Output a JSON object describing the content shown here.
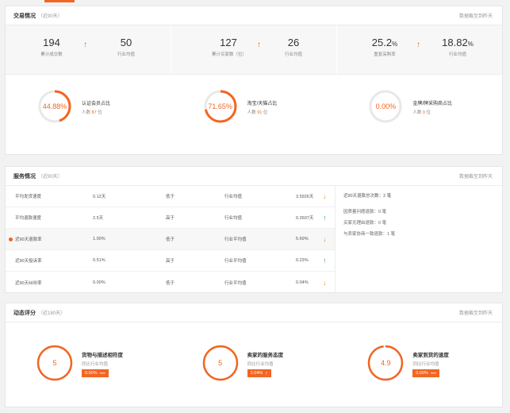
{
  "trade": {
    "title": "交易情况",
    "subtitle": "（近90天）",
    "note": "数据截至到昨天",
    "stats": [
      {
        "value": "194",
        "label": "累计成交数",
        "compare_value": "50",
        "compare_label": "行业均值"
      },
      {
        "value": "127",
        "label": "累计买家数（位）",
        "compare_value": "26",
        "compare_label": "行业均值"
      },
      {
        "value": "25.2",
        "unit": "%",
        "label": "重复采购率",
        "compare_value": "18.82",
        "compare_unit": "%",
        "compare_label": "行业均值"
      }
    ],
    "rings": [
      {
        "value": "44.88%",
        "percent": 44.88,
        "title": "认证会员占比",
        "sub_prefix": "人数",
        "sub_value": "87",
        "sub_suffix": "位"
      },
      {
        "value": "71.65%",
        "percent": 71.65,
        "title": "淘宝/天猫占比",
        "sub_prefix": "人数",
        "sub_value": "91",
        "sub_suffix": "位"
      },
      {
        "value": "0.00%",
        "percent": 0,
        "title": "金牌/牌采购商占比",
        "sub_prefix": "人数",
        "sub_value": "0",
        "sub_suffix": "位"
      }
    ]
  },
  "service": {
    "title": "服务情况",
    "subtitle": "（近90天）",
    "note": "数据截至到昨天",
    "rows": [
      {
        "name": "平均发货速度",
        "value": "0.12天",
        "cmp": "低于",
        "ref": "行业均值",
        "ref_value": "3.5926天",
        "trend": "down"
      },
      {
        "name": "平均退款速度",
        "value": "2.5天",
        "cmp": "高于",
        "ref": "行业均值",
        "ref_value": "0.2607天",
        "trend": "up"
      },
      {
        "name": "近90天退款率",
        "value": "1.00%",
        "cmp": "低于",
        "ref": "行业平均值",
        "ref_value": "5.69%",
        "trend": "down",
        "highlight": true
      },
      {
        "name": "近90天投诉率",
        "value": "0.51%",
        "cmp": "高于",
        "ref": "行业平均值",
        "ref_value": "0.23%",
        "trend": "up"
      },
      {
        "name": "近90天纠纷率",
        "value": "0.00%",
        "cmp": "低于",
        "ref": "行业平均值",
        "ref_value": "0.04%",
        "trend": "down"
      }
    ],
    "trend_glyphs": {
      "down": "↓",
      "up": "↑"
    },
    "side": {
      "total": "近90天退款总次数：2 笔",
      "lines": [
        "因质量问题退款：0 笔",
        "买家无理由退款：0 笔",
        "与卖家协商一致退款：1 笔"
      ]
    }
  },
  "rating": {
    "title": "动态评分",
    "subtitle": "（近180天）",
    "note": "数据截至到昨天",
    "items": [
      {
        "score": "5",
        "fraction": 1.0,
        "title": "货物与描述相符度",
        "sub": "同比行业均值",
        "badge": "0.00%",
        "badge_icon": "—"
      },
      {
        "score": "5",
        "fraction": 1.0,
        "title": "卖家的服务态度",
        "sub": "同比行业均值",
        "badge": "2.04%",
        "badge_icon": "↑"
      },
      {
        "score": "4.9",
        "fraction": 0.98,
        "title": "卖家到货的速度",
        "sub": "同比行业均值",
        "badge": "0.00%",
        "badge_icon": "—"
      }
    ]
  },
  "colors": {
    "accent": "#f26522",
    "ring_track": "#e8e8e8",
    "down": "#f29022",
    "up": "#2aa37e"
  }
}
